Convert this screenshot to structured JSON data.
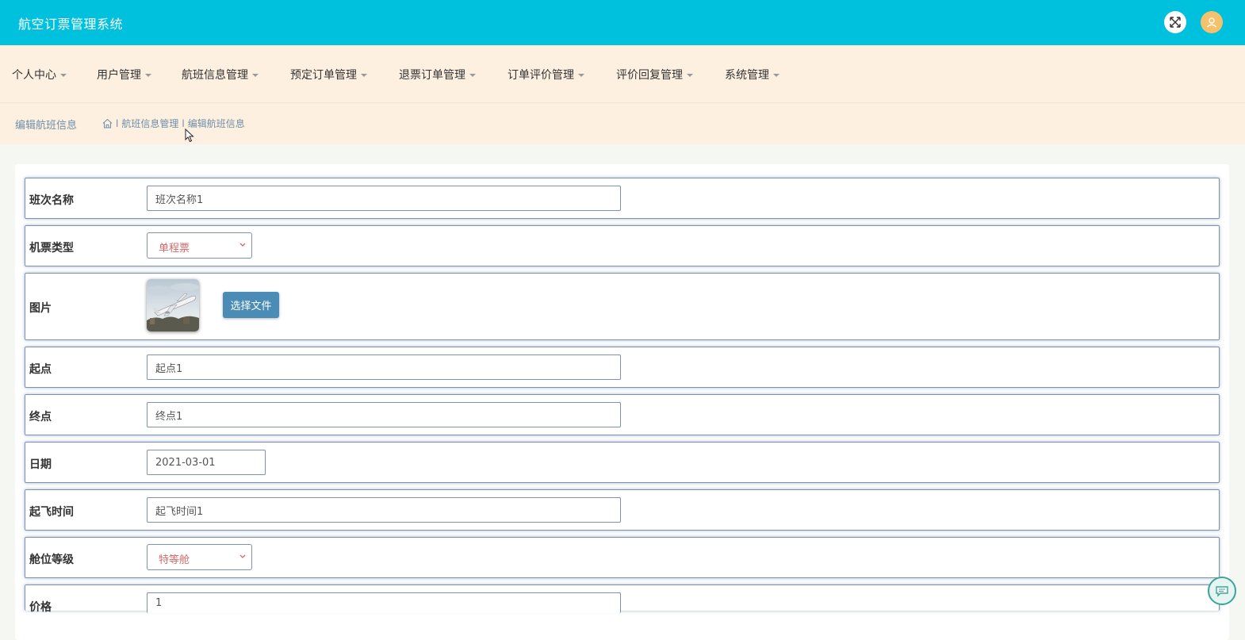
{
  "header": {
    "title": "航空订票管理系统"
  },
  "nav": [
    {
      "label": "个人中心"
    },
    {
      "label": "用户管理"
    },
    {
      "label": "航班信息管理"
    },
    {
      "label": "预定订单管理"
    },
    {
      "label": "退票订单管理"
    },
    {
      "label": "订单评价管理"
    },
    {
      "label": "评价回复管理"
    },
    {
      "label": "系统管理"
    }
  ],
  "page": {
    "title": "编辑航班信息",
    "breadcrumb": [
      "航班信息管理",
      "编辑航班信息"
    ],
    "separator": "l"
  },
  "form": {
    "banci_label": "班次名称",
    "banci_value": "班次名称1",
    "ticket_type_label": "机票类型",
    "ticket_type_value": "单程票",
    "image_label": "图片",
    "choose_file_label": "选择文件",
    "origin_label": "起点",
    "origin_value": "起点1",
    "dest_label": "终点",
    "dest_value": "终点1",
    "date_label": "日期",
    "date_value": "2021-03-01",
    "departure_label": "起飞时间",
    "departure_value": "起飞时间1",
    "cabin_label": "舱位等级",
    "cabin_value": "特等舱",
    "price_label": "价格",
    "price_value": "1"
  },
  "colors": {
    "header_bg": "#00c1dd",
    "nav_bg": "#fdf0e1",
    "select_text": "#d16a68",
    "button_bg": "#4a8cb5",
    "breadcrumb_text": "#6f8fa8"
  }
}
